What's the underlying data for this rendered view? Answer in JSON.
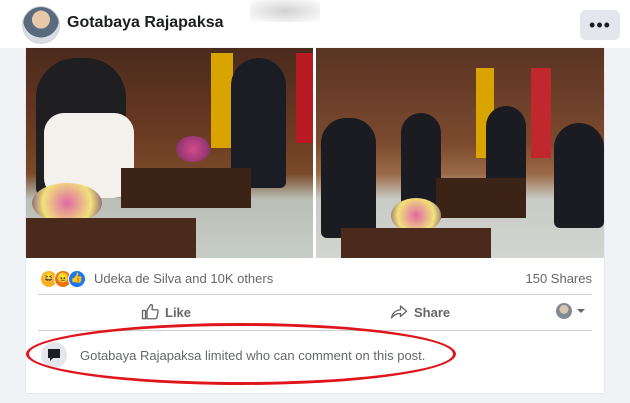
{
  "post": {
    "author": "Gotabaya Rajapaksa",
    "more_label": "•••"
  },
  "stats": {
    "reaction_icons": [
      "haha-icon",
      "angry-icon",
      "like-icon"
    ],
    "reactions_text": "Udeka de Silva and 10K others",
    "shares_text": "150 Shares"
  },
  "actions": {
    "like_label": "Like",
    "share_label": "Share"
  },
  "comments": {
    "notice": "Gotabaya Rajapaksa limited who can comment on this post."
  },
  "colors": {
    "highlight": "#e0141b",
    "muted_text": "#65676b",
    "like_blue": "#1877f2"
  }
}
